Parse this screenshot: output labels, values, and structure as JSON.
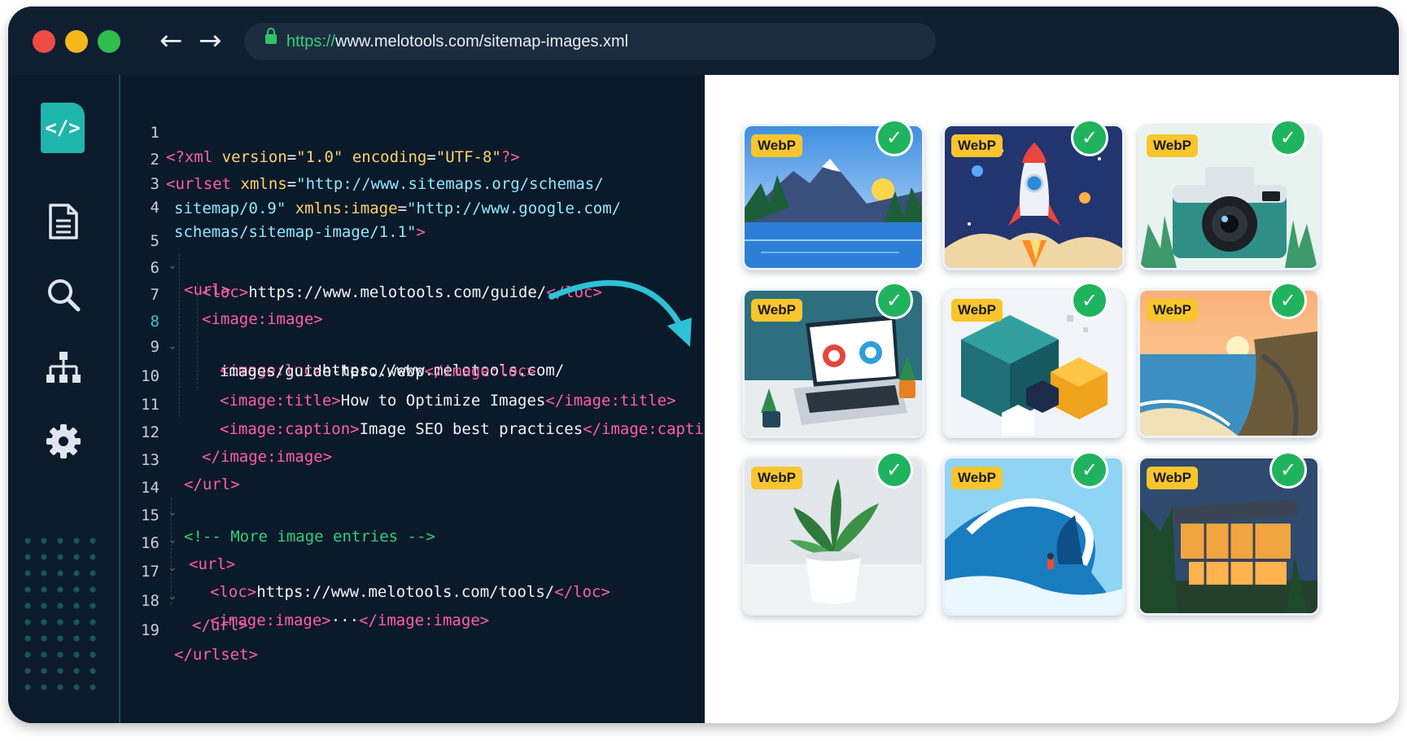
{
  "browser": {
    "url_scheme": "https://",
    "url_rest": "www.melotools.com/sitemap-images.xml",
    "back_icon": "←",
    "forward_icon": "→"
  },
  "sidebar": {
    "code_tile_glyph": "</>"
  },
  "editor": {
    "line_numbers": [
      "1",
      "2",
      "3",
      "4",
      "5",
      "6",
      "7",
      "8",
      "9",
      "10",
      "11",
      "12",
      "13",
      "14",
      "15",
      "16",
      "17",
      "18",
      "19"
    ],
    "fold_glyph": "⌄",
    "collapsed_ellipsis": "···",
    "tokens": {
      "l1_pi_open": "<?xml ",
      "l1_a1": "version",
      "l1_eq": "=",
      "l1_v1": "\"1.0\"",
      "l1_a2": " encoding",
      "l1_v2": "\"UTF-8\"",
      "l1_pi_close": "?>",
      "l2_tag": "<urlset ",
      "l2_attr": "xmlns",
      "l2_val": "\"http://www.sitemaps.org/schemas/",
      "l3_val": "sitemap/0.9\"",
      "l3_attr": " xmlns:image",
      "l3_val2": "\"http://www.google.com/",
      "l4_val": "schemas/sitemap-image/1.1\"",
      "l4_close": ">",
      "url_open": "<url>",
      "url_close": "</url>",
      "loc_open": "<loc>",
      "loc_close": "</loc>",
      "l6_text": "https://www.melotools.com/guide/",
      "image_open": "<image:image>",
      "image_close": "</image:image>",
      "imgloc_open": "<image:loc>",
      "imgloc_close": "</image:loc>",
      "l8_text": "https://www.melotools.com/",
      "l9_text": "images/guide-hero.webp",
      "title_open": "<image:title>",
      "title_close": "</image:title>",
      "l10_text": "How to Optimize Images",
      "caption_open": "<image:caption>",
      "caption_close": "</image:caption>",
      "l11_text": "Image SEO best practices",
      "l14_comment": "<!-- More image entries -->",
      "l16_text": "https://www.melotools.com/tools/",
      "urlset_close": "</urlset>"
    }
  },
  "gallery": {
    "badge": "WebP",
    "check_glyph": "✓",
    "tiles": [
      {
        "name": "mountain-lake-thumbnail"
      },
      {
        "name": "rocket-launch-thumbnail"
      },
      {
        "name": "vintage-camera-thumbnail"
      },
      {
        "name": "laptop-dashboard-thumbnail"
      },
      {
        "name": "isometric-cubes-thumbnail"
      },
      {
        "name": "coastal-sunset-thumbnail"
      },
      {
        "name": "potted-plant-thumbnail"
      },
      {
        "name": "ocean-wave-surfer-thumbnail"
      },
      {
        "name": "modern-house-thumbnail"
      }
    ]
  },
  "colors": {
    "window_bg": "#0c1b2b",
    "tag": "#ff5fa6",
    "attribute": "#ffd36b",
    "string": "#8fe9ff",
    "comment": "#32d07c",
    "accent": "#1fb5ad",
    "badge": "#f8c52e",
    "check": "#20b35e"
  }
}
